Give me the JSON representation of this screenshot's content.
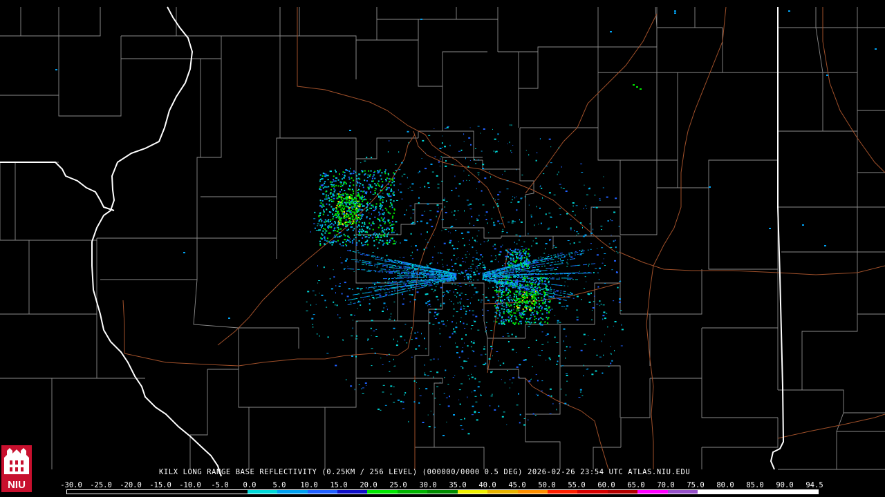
{
  "product": {
    "caption": "KILX LONG RANGE BASE REFLECTIVITY (0.25KM / 256 LEVEL) (000000/0000 0.5 DEG) 2026-02-26 23:54 UTC  ATLAS.NIU.EDU"
  },
  "logo": {
    "text": "NIU",
    "icon": "niu-logo-icon",
    "colors": {
      "red": "#c8102e",
      "white": "#ffffff"
    }
  },
  "scale": {
    "labels": [
      "-30.0",
      "-25.0",
      "-20.0",
      "-15.0",
      "-10.0",
      "-5.0",
      "0.0",
      "5.0",
      "10.0",
      "15.0",
      "20.0",
      "25.0",
      "30.0",
      "35.0",
      "40.0",
      "45.0",
      "50.0",
      "55.0",
      "60.0",
      "65.0",
      "70.0",
      "75.0",
      "80.0",
      "85.0",
      "90.0",
      "94.5"
    ],
    "colors": [
      "#000000",
      "#000000",
      "#000000",
      "#000000",
      "#000000",
      "#000000",
      "#00d8d8",
      "#00a0f0",
      "#2060ff",
      "#1010c8",
      "#00e800",
      "#00b400",
      "#008c00",
      "#f0f000",
      "#e8b400",
      "#ff9000",
      "#ff2000",
      "#d80000",
      "#b40000",
      "#ff00ff",
      "#9650c8",
      "#ffffff",
      "#ffffff",
      "#ffffff",
      "#ffffff"
    ]
  },
  "map": {
    "radar_site": "KILX",
    "colors": {
      "county_lines": "#8c8c8c",
      "state_lines": "#ffffff",
      "highways": "#a0502a"
    }
  }
}
